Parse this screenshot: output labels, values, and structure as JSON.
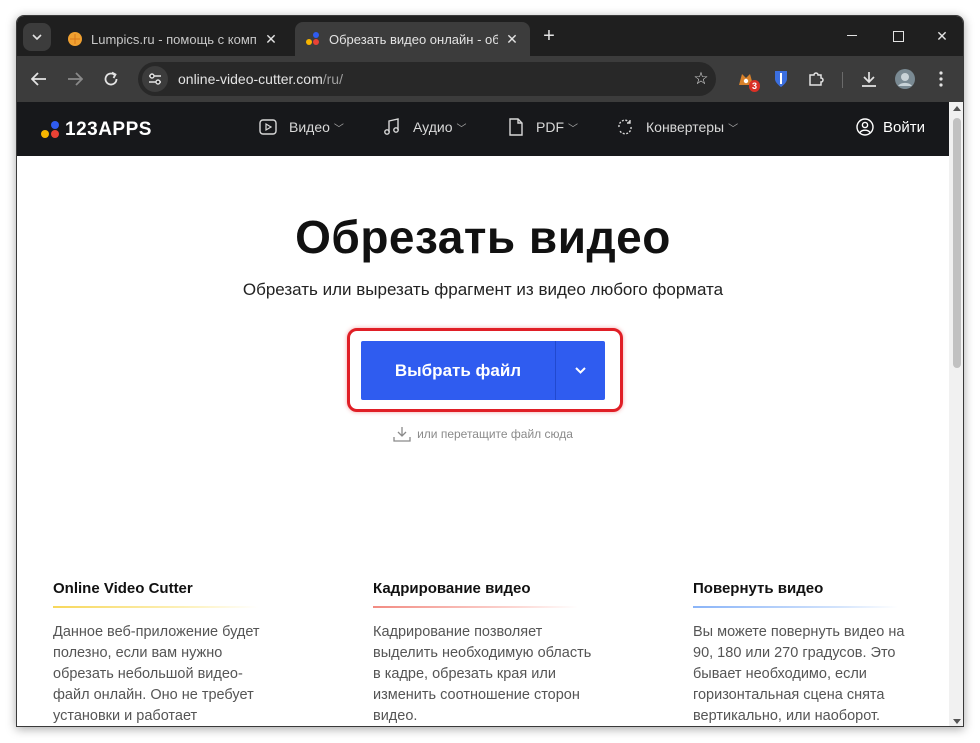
{
  "browser": {
    "tabs": [
      {
        "title": "Lumpics.ru - помощь с компьютером",
        "active": false
      },
      {
        "title": "Обрезать видео онлайн - обрезать видео",
        "active": true
      }
    ],
    "new_tab": "+",
    "address": {
      "host": "online-video-cutter.com",
      "path": "/ru/"
    },
    "extension_badge": "3"
  },
  "site": {
    "logo": "123APPS",
    "menu": [
      {
        "label": "Видео",
        "icon": "video-icon"
      },
      {
        "label": "Аудио",
        "icon": "music-icon"
      },
      {
        "label": "PDF",
        "icon": "pdf-icon"
      },
      {
        "label": "Конвертеры",
        "icon": "convert-icon"
      }
    ],
    "login": "Войти"
  },
  "hero": {
    "title": "Обрезать видео",
    "subtitle": "Обрезать или вырезать фрагмент из видео любого формата",
    "button": "Выбрать файл",
    "drop_hint": "или перетащите файл сюда"
  },
  "features": [
    {
      "title": "Online Video Cutter",
      "text": "Данное веб-приложение будет полезно, если вам нужно обрезать небольшой видео-файл онлайн. Оно не требует установки и работает"
    },
    {
      "title": "Кадрирование видео",
      "text": "Кадрирование позволяет выделить необходимую область в кадре, обрезать края или изменить соотношение сторон видео."
    },
    {
      "title": "Повернуть видео",
      "text": "Вы можете повернуть видео на 90, 180 или 270 градусов. Это бывает необходимо, если горизонтальная сцена снята вертикально, или наоборот."
    }
  ],
  "colors": {
    "accent": "#2f5cf0",
    "highlight": "#e01f26",
    "header_bg": "#17181b"
  }
}
